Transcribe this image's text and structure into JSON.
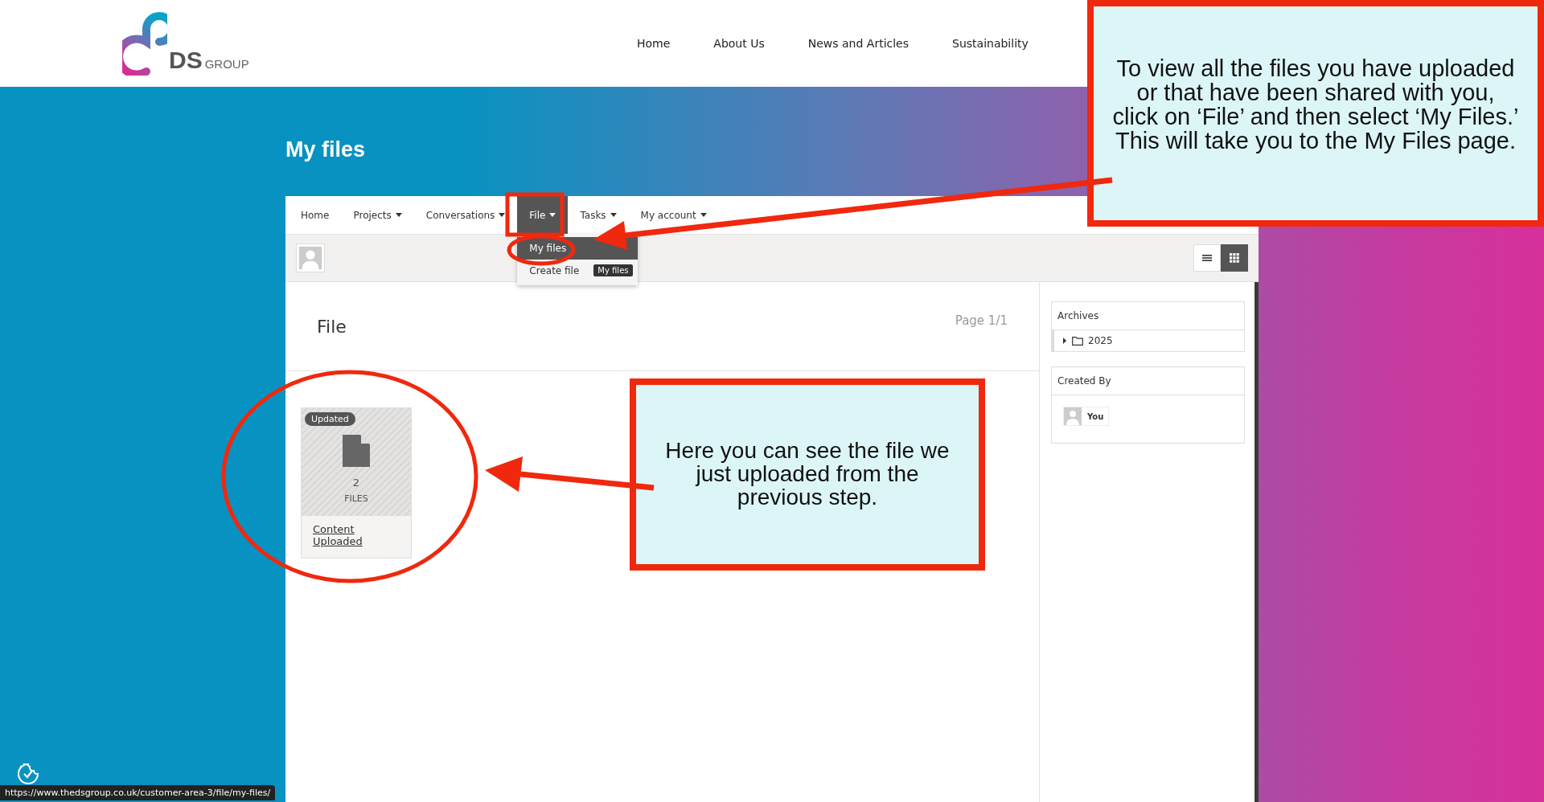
{
  "logo": {
    "name": "DS",
    "suffix": "GROUP"
  },
  "site_nav": [
    "Home",
    "About Us",
    "News and Articles",
    "Sustainability"
  ],
  "page_title": "My files",
  "app_nav": [
    {
      "label": "Home",
      "has_menu": false,
      "selected": false
    },
    {
      "label": "Projects",
      "has_menu": true,
      "selected": false
    },
    {
      "label": "Conversations",
      "has_menu": true,
      "selected": false
    },
    {
      "label": "File",
      "has_menu": true,
      "selected": true
    },
    {
      "label": "Tasks",
      "has_menu": true,
      "selected": false
    },
    {
      "label": "My account",
      "has_menu": true,
      "selected": false
    }
  ],
  "file_menu": {
    "items": [
      {
        "label": "My files",
        "selected": true
      },
      {
        "label": "Create file",
        "selected": false
      }
    ],
    "tooltip": "My files"
  },
  "view_toggle": [
    {
      "kind": "list",
      "selected": false
    },
    {
      "kind": "grid",
      "selected": true
    }
  ],
  "content": {
    "heading": "File",
    "page": "Page 1/1",
    "cards": [
      {
        "badge": "Updated",
        "count": "2",
        "unit": "FILES",
        "title": "Content Uploaded"
      }
    ]
  },
  "sidebar": {
    "archives": {
      "title": "Archives",
      "items": [
        {
          "label": "2025",
          "expanded": false
        }
      ]
    },
    "created_by": {
      "title": "Created By",
      "users": [
        "You"
      ]
    }
  },
  "callouts": [
    {
      "text": "To view all the files you have uploaded or that have been shared with you, click on ‘File’ and then select ‘My Files.’ This will take you to the My Files page."
    },
    {
      "text": "Here you can see the file we just uploaded from the previous step."
    }
  ],
  "status_url": "https://www.thedsgroup.co.uk/customer-area-3/file/my-files/"
}
